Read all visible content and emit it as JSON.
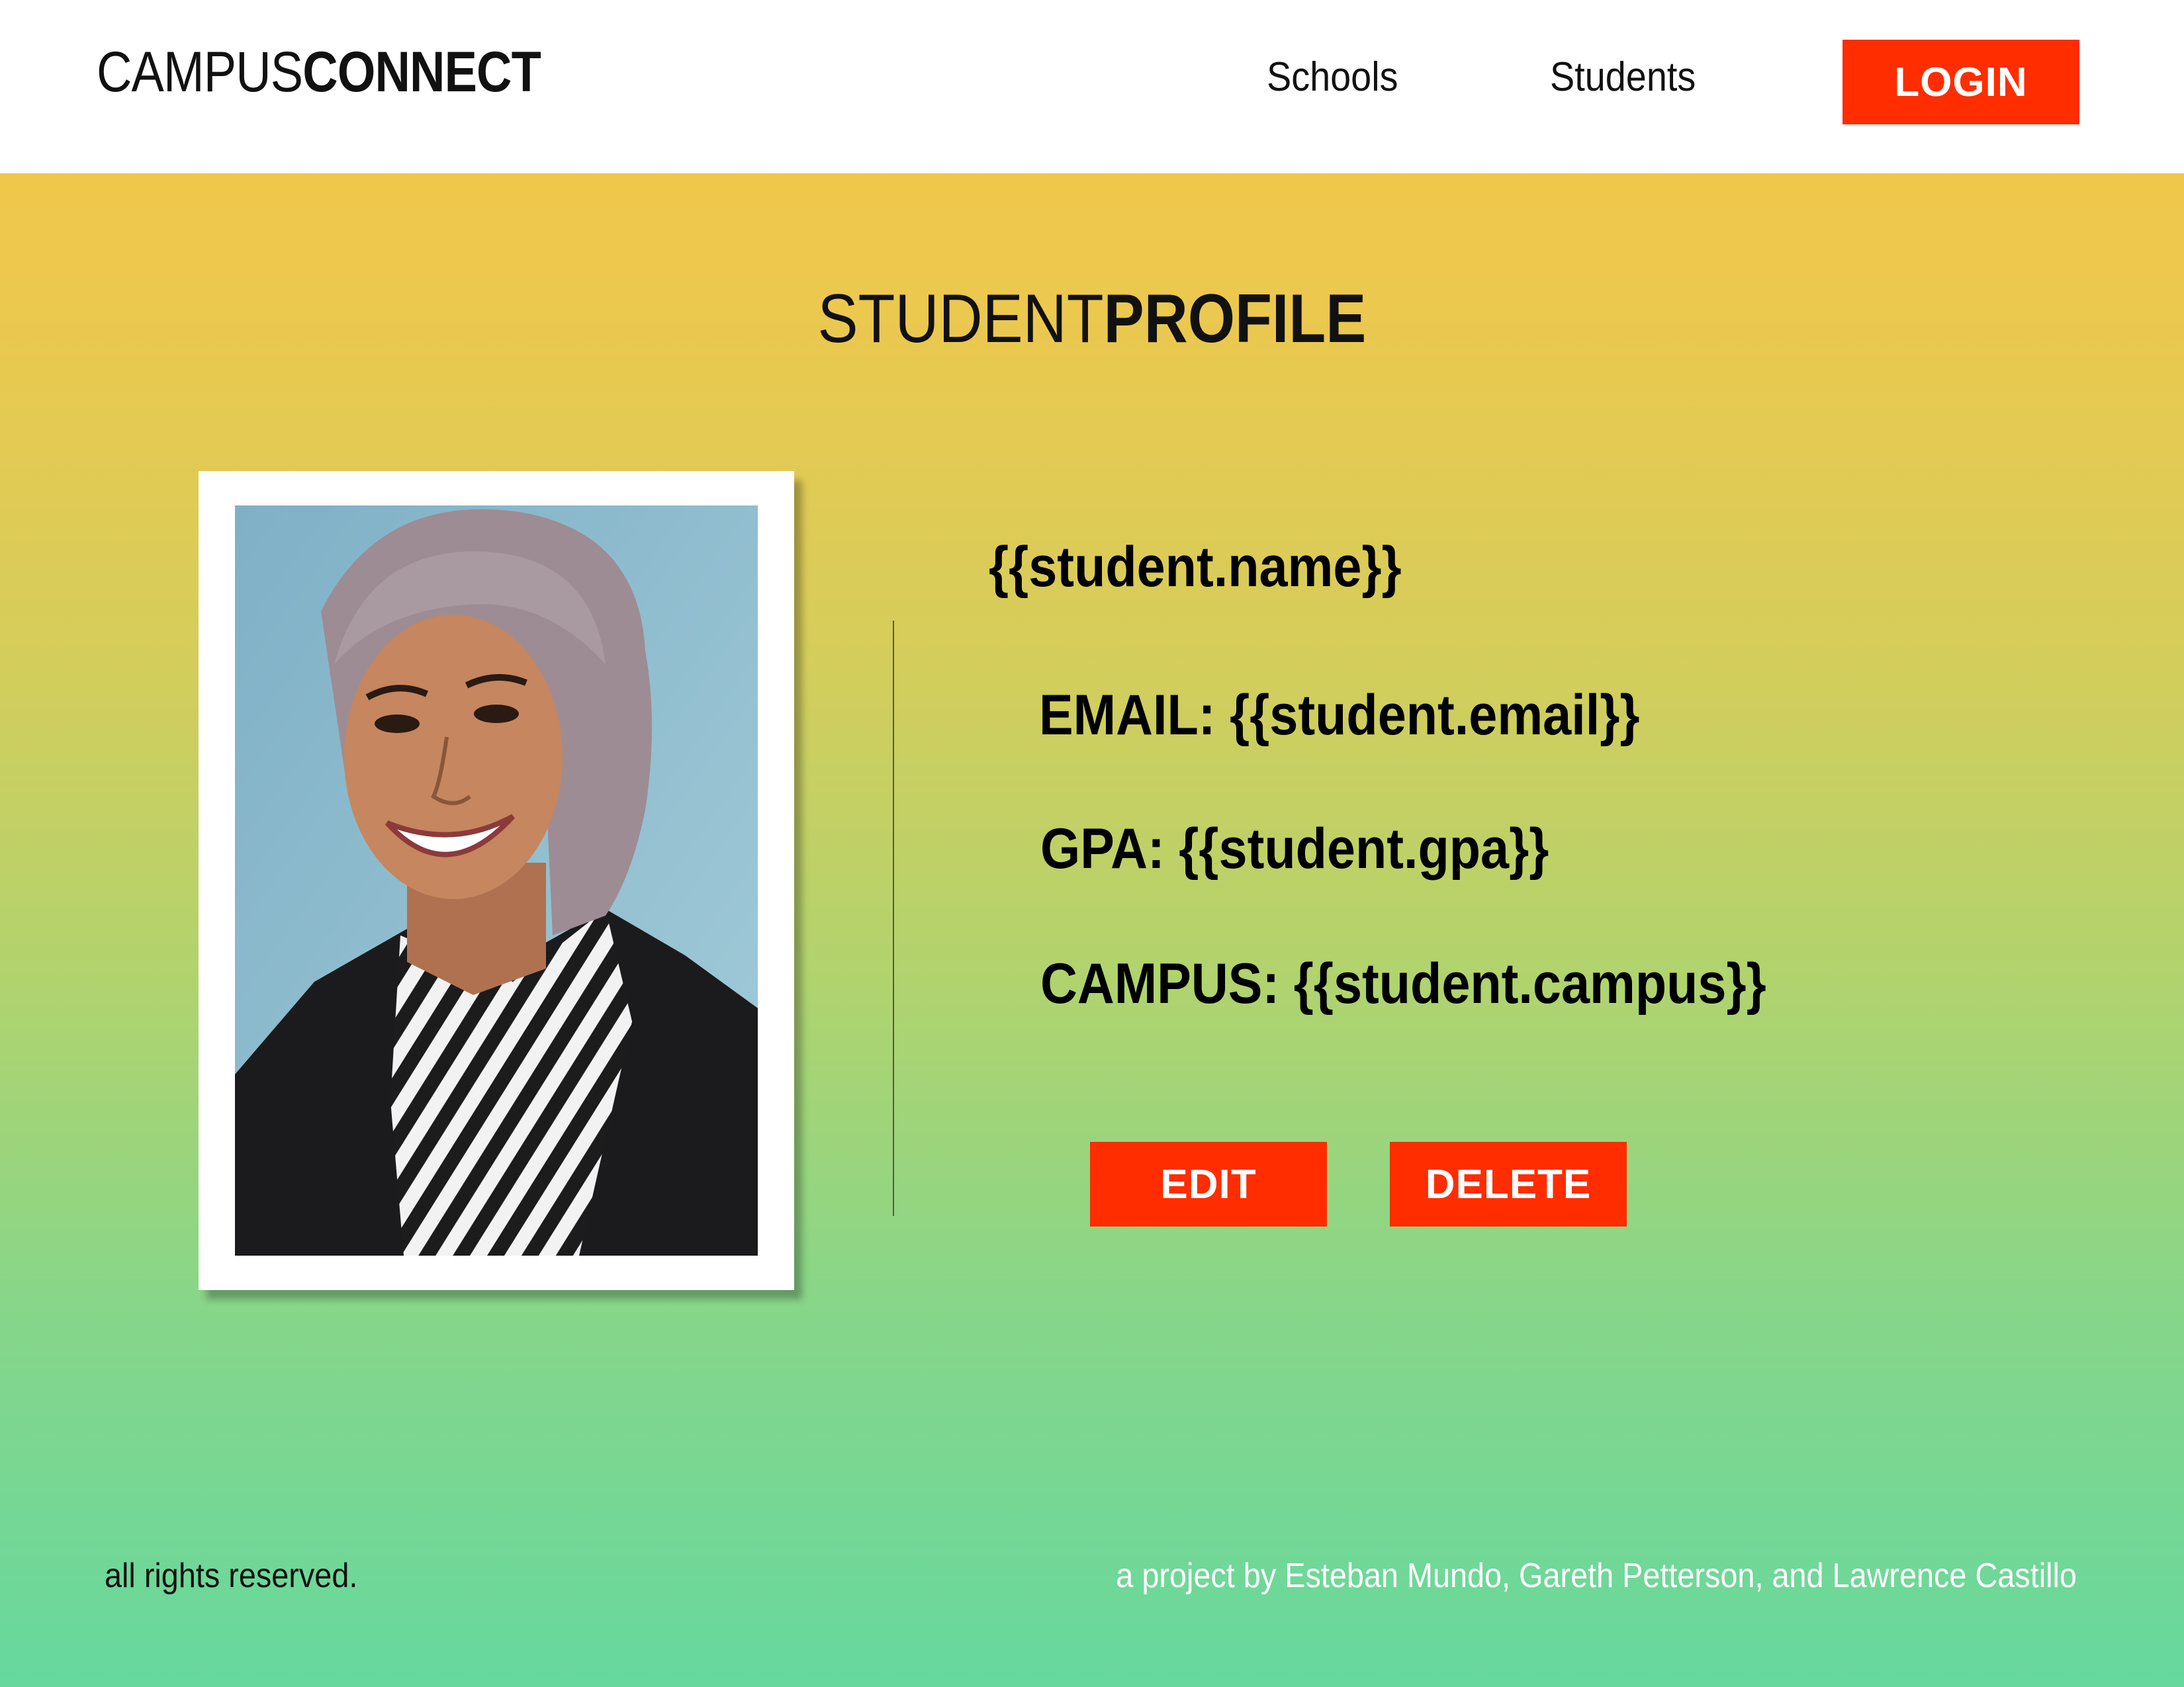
{
  "header": {
    "logo_thin": "CAMPUS",
    "logo_bold": "CONNECT",
    "nav": [
      {
        "label": "Schools"
      },
      {
        "label": "Students"
      }
    ],
    "login_label": "LOGIN"
  },
  "page": {
    "title_thin": "STUDENT",
    "title_bold": "PROFILE"
  },
  "profile": {
    "photo_icon": "student-photo",
    "name": "{{student.name}}",
    "email_label": "EMAIL:",
    "email_value": "{{student.email}}",
    "gpa_label": "GPA:",
    "gpa_value": "{{student.gpa}}",
    "campus_label": "CAMPUS:",
    "campus_value": "{{student.campus}}",
    "edit_label": "EDIT",
    "delete_label": "DELETE"
  },
  "footer": {
    "left": "all rights reserved.",
    "right": "a project by Esteban Mundo, Gareth Petterson, and Lawrence Castillo"
  },
  "colors": {
    "accent": "#ff2d00",
    "gradient_top": "#f4c646",
    "gradient_bottom": "#66d89e",
    "header_bg": "#ffffff"
  }
}
